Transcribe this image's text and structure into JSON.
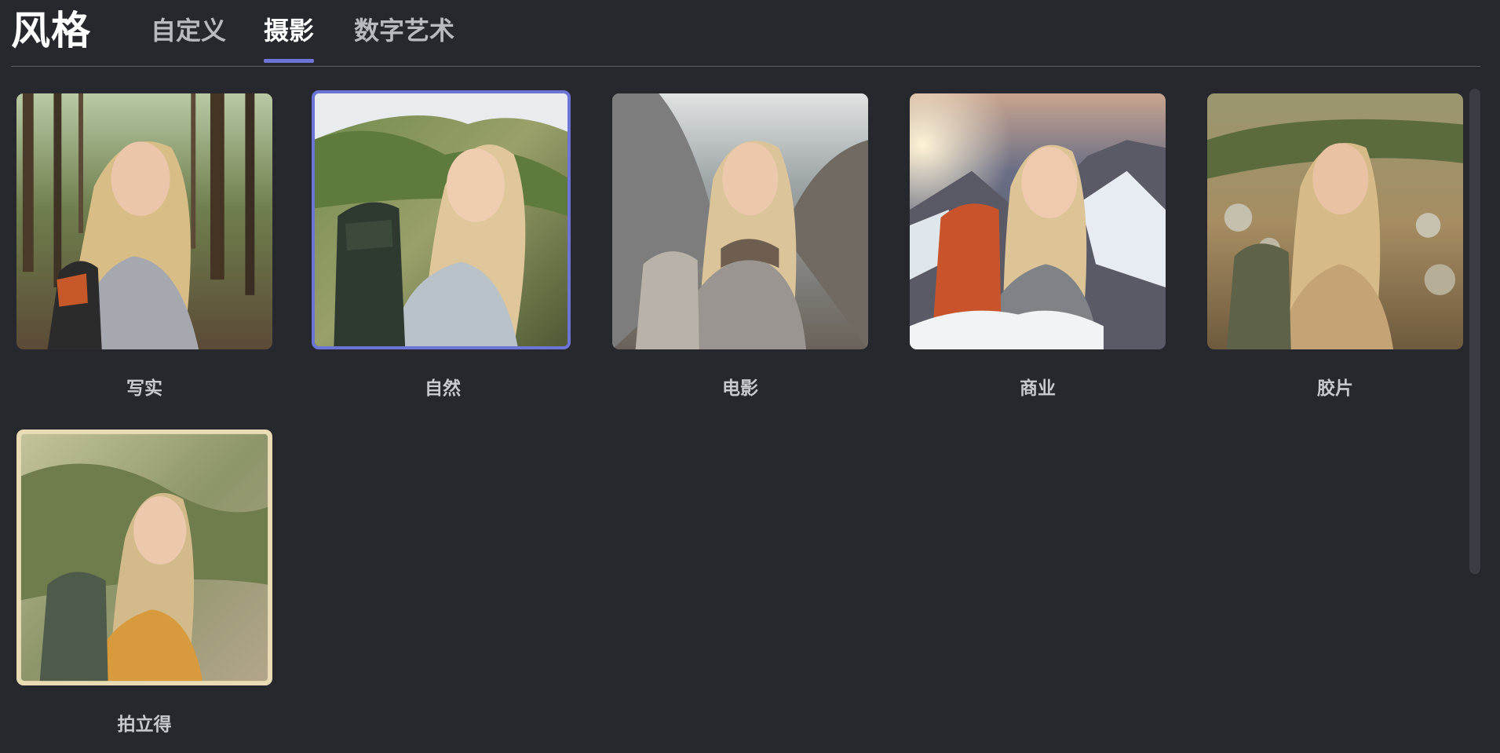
{
  "header": {
    "title": "风格",
    "tabs": [
      {
        "label": "自定义",
        "active": false
      },
      {
        "label": "摄影",
        "active": true
      },
      {
        "label": "数字艺术",
        "active": false
      }
    ],
    "accent_color": "#6c74d6"
  },
  "styles": {
    "items": [
      {
        "label": "写实",
        "selected": false
      },
      {
        "label": "自然",
        "selected": true
      },
      {
        "label": "电影",
        "selected": false
      },
      {
        "label": "商业",
        "selected": false
      },
      {
        "label": "胶片",
        "selected": false
      },
      {
        "label": "拍立得",
        "selected": false
      }
    ]
  }
}
